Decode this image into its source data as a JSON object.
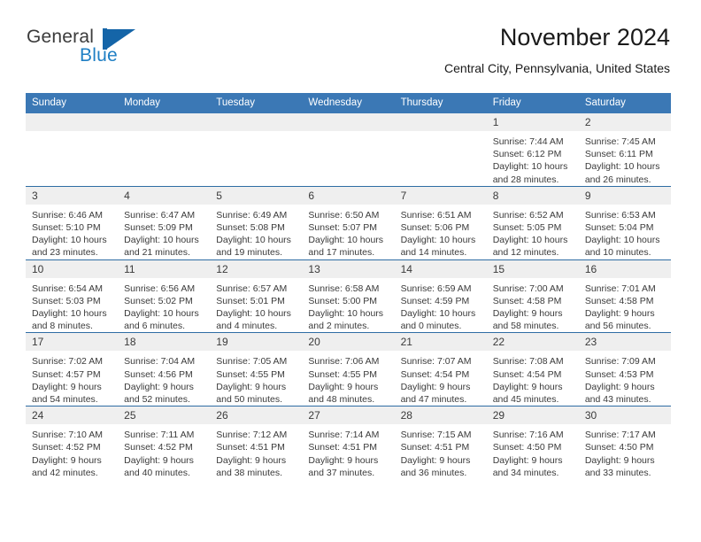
{
  "brand": {
    "name_part1": "General",
    "name_part2": "Blue"
  },
  "header": {
    "title": "November 2024",
    "subtitle": "Central City, Pennsylvania, United States"
  },
  "weekdays": [
    "Sunday",
    "Monday",
    "Tuesday",
    "Wednesday",
    "Thursday",
    "Friday",
    "Saturday"
  ],
  "colors": {
    "header_blue": "#3b78b5",
    "row_divider_blue": "#2e6da4",
    "daynum_band": "#efefef",
    "brand_blue": "#1f7fc4",
    "text": "#3a3a3a"
  },
  "labels": {
    "sunrise_prefix": "Sunrise:",
    "sunset_prefix": "Sunset:",
    "daylight_prefix": "Daylight:"
  },
  "weeks": [
    [
      {
        "day": "",
        "blank": true
      },
      {
        "day": "",
        "blank": true
      },
      {
        "day": "",
        "blank": true
      },
      {
        "day": "",
        "blank": true
      },
      {
        "day": "",
        "blank": true
      },
      {
        "day": "1",
        "sunrise": "Sunrise: 7:44 AM",
        "sunset": "Sunset: 6:12 PM",
        "daylight_line1": "Daylight: 10 hours",
        "daylight_line2": "and 28 minutes."
      },
      {
        "day": "2",
        "sunrise": "Sunrise: 7:45 AM",
        "sunset": "Sunset: 6:11 PM",
        "daylight_line1": "Daylight: 10 hours",
        "daylight_line2": "and 26 minutes."
      }
    ],
    [
      {
        "day": "3",
        "sunrise": "Sunrise: 6:46 AM",
        "sunset": "Sunset: 5:10 PM",
        "daylight_line1": "Daylight: 10 hours",
        "daylight_line2": "and 23 minutes."
      },
      {
        "day": "4",
        "sunrise": "Sunrise: 6:47 AM",
        "sunset": "Sunset: 5:09 PM",
        "daylight_line1": "Daylight: 10 hours",
        "daylight_line2": "and 21 minutes."
      },
      {
        "day": "5",
        "sunrise": "Sunrise: 6:49 AM",
        "sunset": "Sunset: 5:08 PM",
        "daylight_line1": "Daylight: 10 hours",
        "daylight_line2": "and 19 minutes."
      },
      {
        "day": "6",
        "sunrise": "Sunrise: 6:50 AM",
        "sunset": "Sunset: 5:07 PM",
        "daylight_line1": "Daylight: 10 hours",
        "daylight_line2": "and 17 minutes."
      },
      {
        "day": "7",
        "sunrise": "Sunrise: 6:51 AM",
        "sunset": "Sunset: 5:06 PM",
        "daylight_line1": "Daylight: 10 hours",
        "daylight_line2": "and 14 minutes."
      },
      {
        "day": "8",
        "sunrise": "Sunrise: 6:52 AM",
        "sunset": "Sunset: 5:05 PM",
        "daylight_line1": "Daylight: 10 hours",
        "daylight_line2": "and 12 minutes."
      },
      {
        "day": "9",
        "sunrise": "Sunrise: 6:53 AM",
        "sunset": "Sunset: 5:04 PM",
        "daylight_line1": "Daylight: 10 hours",
        "daylight_line2": "and 10 minutes."
      }
    ],
    [
      {
        "day": "10",
        "sunrise": "Sunrise: 6:54 AM",
        "sunset": "Sunset: 5:03 PM",
        "daylight_line1": "Daylight: 10 hours",
        "daylight_line2": "and 8 minutes."
      },
      {
        "day": "11",
        "sunrise": "Sunrise: 6:56 AM",
        "sunset": "Sunset: 5:02 PM",
        "daylight_line1": "Daylight: 10 hours",
        "daylight_line2": "and 6 minutes."
      },
      {
        "day": "12",
        "sunrise": "Sunrise: 6:57 AM",
        "sunset": "Sunset: 5:01 PM",
        "daylight_line1": "Daylight: 10 hours",
        "daylight_line2": "and 4 minutes."
      },
      {
        "day": "13",
        "sunrise": "Sunrise: 6:58 AM",
        "sunset": "Sunset: 5:00 PM",
        "daylight_line1": "Daylight: 10 hours",
        "daylight_line2": "and 2 minutes."
      },
      {
        "day": "14",
        "sunrise": "Sunrise: 6:59 AM",
        "sunset": "Sunset: 4:59 PM",
        "daylight_line1": "Daylight: 10 hours",
        "daylight_line2": "and 0 minutes."
      },
      {
        "day": "15",
        "sunrise": "Sunrise: 7:00 AM",
        "sunset": "Sunset: 4:58 PM",
        "daylight_line1": "Daylight: 9 hours",
        "daylight_line2": "and 58 minutes."
      },
      {
        "day": "16",
        "sunrise": "Sunrise: 7:01 AM",
        "sunset": "Sunset: 4:58 PM",
        "daylight_line1": "Daylight: 9 hours",
        "daylight_line2": "and 56 minutes."
      }
    ],
    [
      {
        "day": "17",
        "sunrise": "Sunrise: 7:02 AM",
        "sunset": "Sunset: 4:57 PM",
        "daylight_line1": "Daylight: 9 hours",
        "daylight_line2": "and 54 minutes."
      },
      {
        "day": "18",
        "sunrise": "Sunrise: 7:04 AM",
        "sunset": "Sunset: 4:56 PM",
        "daylight_line1": "Daylight: 9 hours",
        "daylight_line2": "and 52 minutes."
      },
      {
        "day": "19",
        "sunrise": "Sunrise: 7:05 AM",
        "sunset": "Sunset: 4:55 PM",
        "daylight_line1": "Daylight: 9 hours",
        "daylight_line2": "and 50 minutes."
      },
      {
        "day": "20",
        "sunrise": "Sunrise: 7:06 AM",
        "sunset": "Sunset: 4:55 PM",
        "daylight_line1": "Daylight: 9 hours",
        "daylight_line2": "and 48 minutes."
      },
      {
        "day": "21",
        "sunrise": "Sunrise: 7:07 AM",
        "sunset": "Sunset: 4:54 PM",
        "daylight_line1": "Daylight: 9 hours",
        "daylight_line2": "and 47 minutes."
      },
      {
        "day": "22",
        "sunrise": "Sunrise: 7:08 AM",
        "sunset": "Sunset: 4:54 PM",
        "daylight_line1": "Daylight: 9 hours",
        "daylight_line2": "and 45 minutes."
      },
      {
        "day": "23",
        "sunrise": "Sunrise: 7:09 AM",
        "sunset": "Sunset: 4:53 PM",
        "daylight_line1": "Daylight: 9 hours",
        "daylight_line2": "and 43 minutes."
      }
    ],
    [
      {
        "day": "24",
        "sunrise": "Sunrise: 7:10 AM",
        "sunset": "Sunset: 4:52 PM",
        "daylight_line1": "Daylight: 9 hours",
        "daylight_line2": "and 42 minutes."
      },
      {
        "day": "25",
        "sunrise": "Sunrise: 7:11 AM",
        "sunset": "Sunset: 4:52 PM",
        "daylight_line1": "Daylight: 9 hours",
        "daylight_line2": "and 40 minutes."
      },
      {
        "day": "26",
        "sunrise": "Sunrise: 7:12 AM",
        "sunset": "Sunset: 4:51 PM",
        "daylight_line1": "Daylight: 9 hours",
        "daylight_line2": "and 38 minutes."
      },
      {
        "day": "27",
        "sunrise": "Sunrise: 7:14 AM",
        "sunset": "Sunset: 4:51 PM",
        "daylight_line1": "Daylight: 9 hours",
        "daylight_line2": "and 37 minutes."
      },
      {
        "day": "28",
        "sunrise": "Sunrise: 7:15 AM",
        "sunset": "Sunset: 4:51 PM",
        "daylight_line1": "Daylight: 9 hours",
        "daylight_line2": "and 36 minutes."
      },
      {
        "day": "29",
        "sunrise": "Sunrise: 7:16 AM",
        "sunset": "Sunset: 4:50 PM",
        "daylight_line1": "Daylight: 9 hours",
        "daylight_line2": "and 34 minutes."
      },
      {
        "day": "30",
        "sunrise": "Sunrise: 7:17 AM",
        "sunset": "Sunset: 4:50 PM",
        "daylight_line1": "Daylight: 9 hours",
        "daylight_line2": "and 33 minutes."
      }
    ]
  ]
}
